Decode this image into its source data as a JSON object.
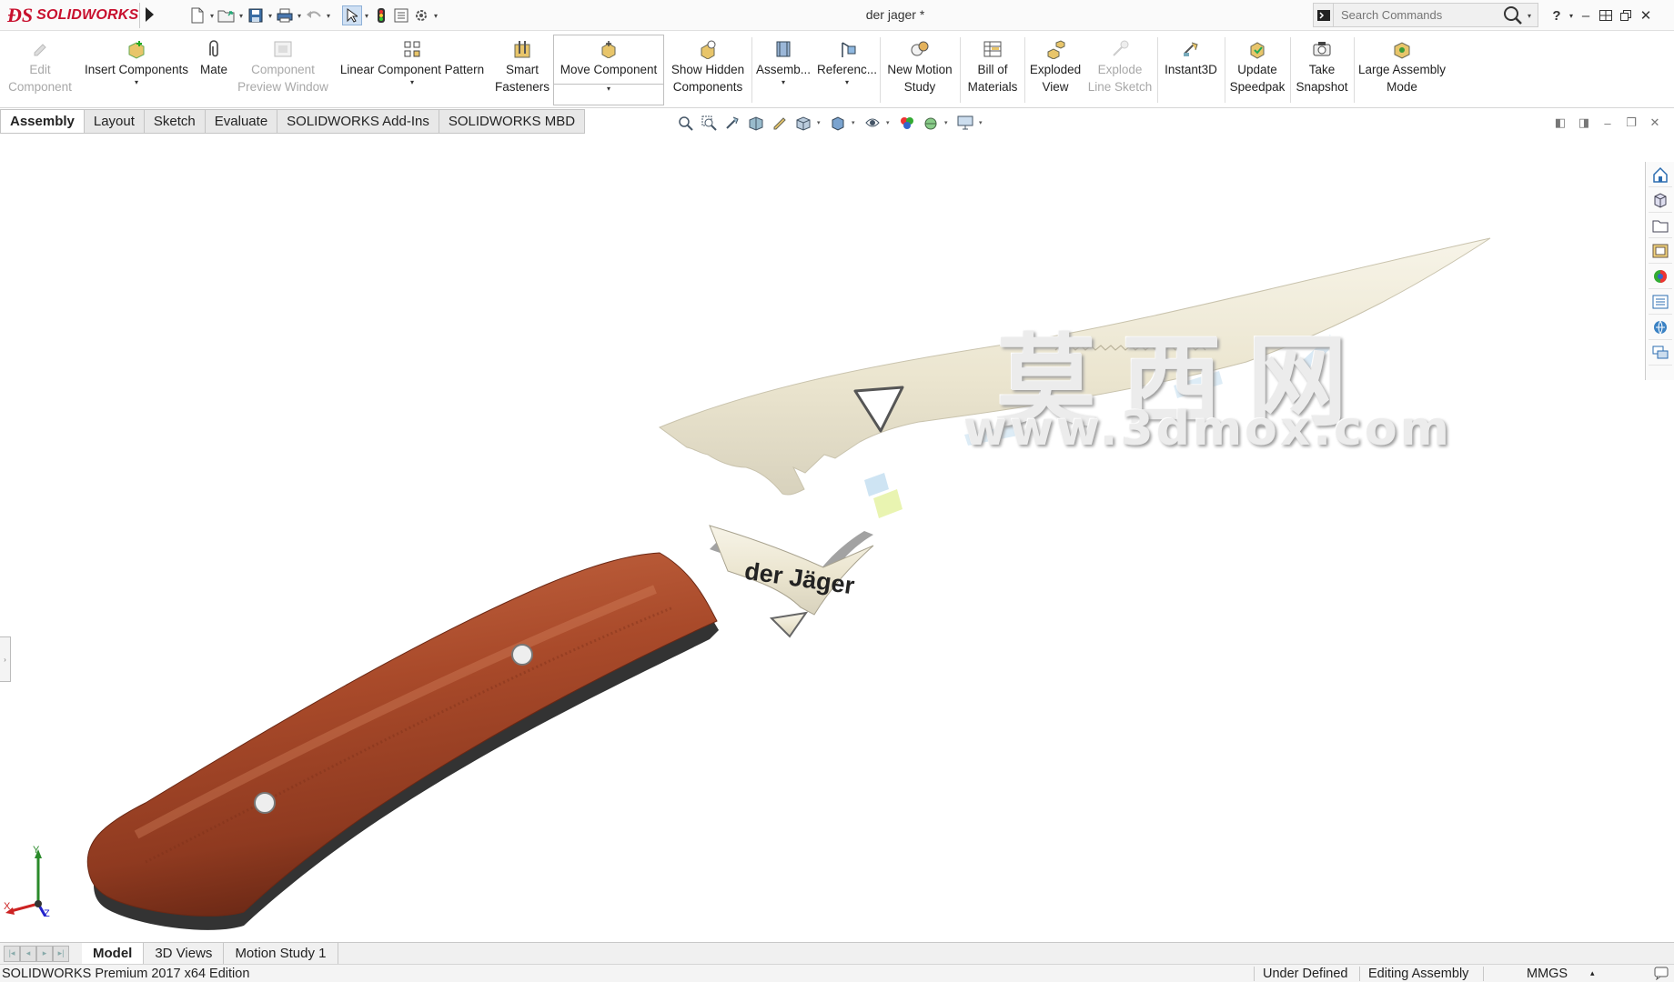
{
  "app": {
    "brand": "SOLIDWORKS",
    "document_title": "der jager *"
  },
  "search": {
    "placeholder": "Search Commands"
  },
  "ribbon": {
    "edit_component": [
      "Edit",
      "Component"
    ],
    "insert_components": "Insert Components",
    "mate": "Mate",
    "component_preview": [
      "Component",
      "Preview Window"
    ],
    "linear_pattern": "Linear Component Pattern",
    "smart_fasteners": [
      "Smart",
      "Fasteners"
    ],
    "move_component": "Move Component",
    "show_hidden": [
      "Show Hidden",
      "Components"
    ],
    "assembly_features": "Assemb...",
    "reference_geometry": "Referenc...",
    "new_motion_study": [
      "New Motion",
      "Study"
    ],
    "bill_of_materials": [
      "Bill of",
      "Materials"
    ],
    "exploded_view": [
      "Exploded",
      "View"
    ],
    "explode_line_sketch": [
      "Explode",
      "Line Sketch"
    ],
    "instant3d": "Instant3D",
    "update_speedpak": [
      "Update",
      "Speedpak"
    ],
    "take_snapshot": [
      "Take",
      "Snapshot"
    ],
    "large_assembly_mode": [
      "Large Assembly",
      "Mode"
    ]
  },
  "tabs": [
    "Assembly",
    "Layout",
    "Sketch",
    "Evaluate",
    "SOLIDWORKS Add-Ins",
    "SOLIDWORKS MBD"
  ],
  "model": {
    "blade_engraving": "der Jäger"
  },
  "watermark": {
    "chinese": "莫西网",
    "url": "www.3dmox.com"
  },
  "triad": {
    "x": "X",
    "y": "Y",
    "z": "Z"
  },
  "bottom_tabs": [
    "Model",
    "3D Views",
    "Motion Study 1"
  ],
  "status": {
    "edition": "SOLIDWORKS Premium 2017 x64 Edition",
    "definition": "Under Defined",
    "mode": "Editing Assembly",
    "units": "MMGS"
  },
  "colors": {
    "brand_red": "#c8102e",
    "handle_wood": "#a0452a",
    "blade_steel": "#ece8d8"
  }
}
